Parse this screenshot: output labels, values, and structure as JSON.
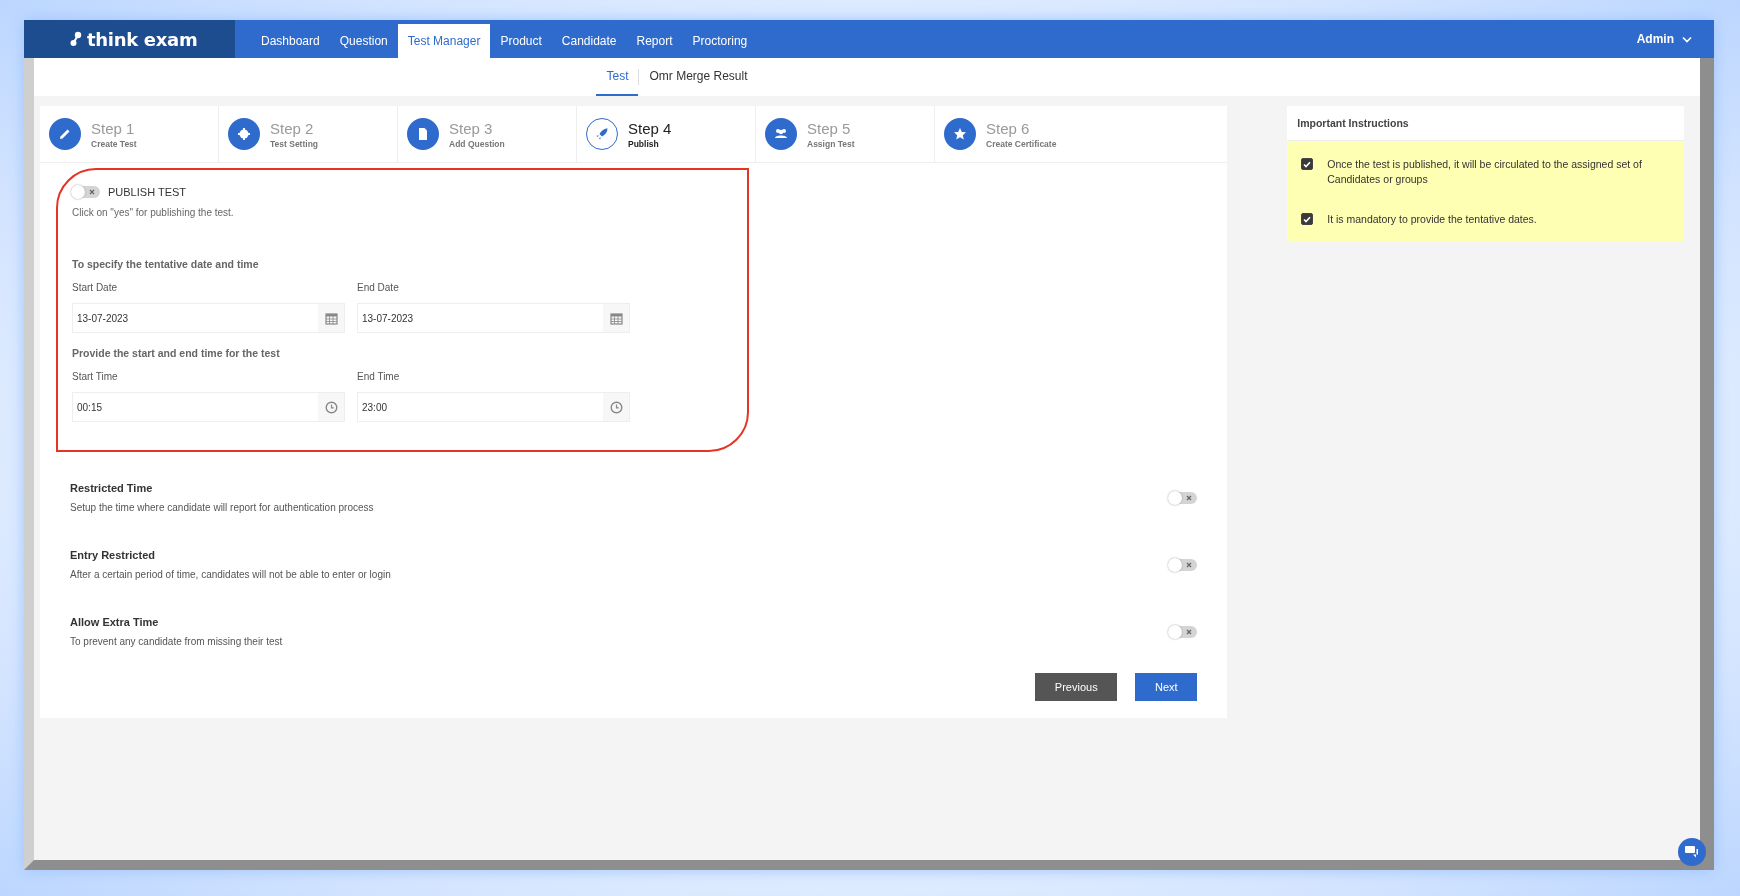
{
  "brand": {
    "name": "think exam"
  },
  "nav": [
    {
      "label": "Dashboard",
      "selected": false
    },
    {
      "label": "Question",
      "selected": false
    },
    {
      "label": "Test Manager",
      "selected": true
    },
    {
      "label": "Product",
      "selected": false
    },
    {
      "label": "Candidate",
      "selected": false
    },
    {
      "label": "Report",
      "selected": false
    },
    {
      "label": "Proctoring",
      "selected": false
    }
  ],
  "user": {
    "name": "Admin"
  },
  "subnav": [
    {
      "label": "Test",
      "selected": true
    },
    {
      "label": "Omr Merge Result",
      "selected": false
    }
  ],
  "steps": [
    {
      "title": "Step 1",
      "subtitle": "Create Test",
      "selected": false
    },
    {
      "title": "Step 2",
      "subtitle": "Test Setting",
      "selected": false
    },
    {
      "title": "Step 3",
      "subtitle": "Add Question",
      "selected": false
    },
    {
      "title": "Step 4",
      "subtitle": "Publish",
      "selected": true
    },
    {
      "title": "Step 5",
      "subtitle": "Assign Test",
      "selected": false
    },
    {
      "title": "Step 6",
      "subtitle": "Create Certificate",
      "selected": false
    }
  ],
  "publish": {
    "label": "PUBLISH TEST",
    "on": false,
    "hint": "Click on \"yes\" for publishing the test.",
    "date_heading": "To specify the tentative date and time",
    "dates": [
      {
        "label": "Start Date",
        "value": "13-07-2023",
        "kind": "date"
      },
      {
        "label": "End Date",
        "value": "13-07-2023",
        "kind": "date"
      }
    ],
    "time_heading": "Provide the start and end time for the test",
    "times": [
      {
        "label": "Start Time",
        "value": "00:15",
        "kind": "time"
      },
      {
        "label": "End Time",
        "value": "23:00",
        "kind": "time"
      }
    ]
  },
  "options": [
    {
      "title": "Restricted Time",
      "description": "Setup the time where candidate will report for authentication process",
      "on": false
    },
    {
      "title": "Entry Restricted",
      "description": "After a certain period of time, candidates will not be able to enter or login",
      "on": false
    },
    {
      "title": "Allow Extra Time",
      "description": "To prevent any candidate from missing their test",
      "on": false
    }
  ],
  "buttons": [
    {
      "label": "Previous",
      "kind": "secondary"
    },
    {
      "label": "Next",
      "kind": "primary"
    }
  ],
  "instructions": {
    "title": "Important Instructions",
    "items": [
      {
        "text": "Once the test is published, it will be circulated to the assigned set of Candidates or groups",
        "checked": true
      },
      {
        "text": "It is mandatory to provide the tentative dates.",
        "checked": true
      }
    ]
  }
}
